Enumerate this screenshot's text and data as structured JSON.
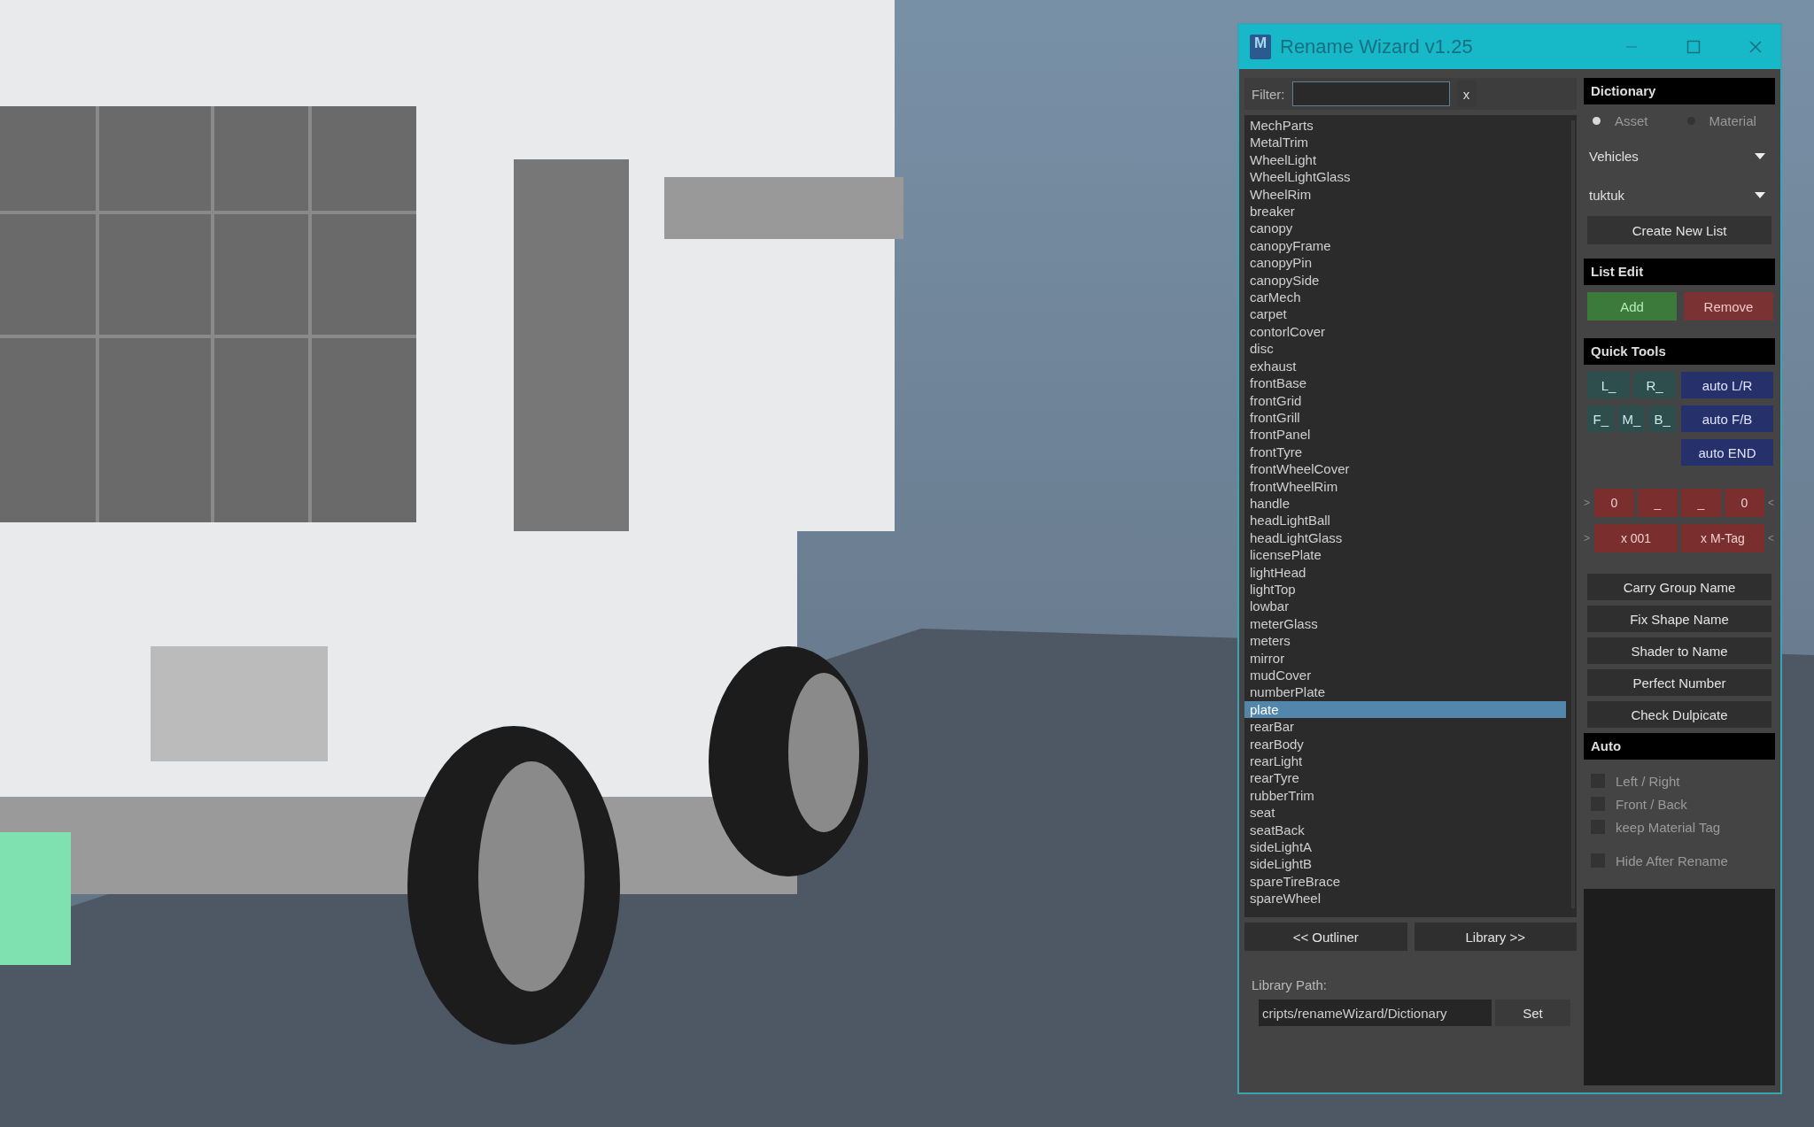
{
  "window": {
    "logo": "M",
    "title": "Rename Wizard v1.25"
  },
  "filter": {
    "label": "Filter:",
    "clear": "x"
  },
  "items": [
    {
      "name": "MechParts",
      "selected": false
    },
    {
      "name": "MetalTrim",
      "selected": false
    },
    {
      "name": "WheelLight",
      "selected": false
    },
    {
      "name": "WheelLightGlass",
      "selected": false
    },
    {
      "name": "WheelRim",
      "selected": false
    },
    {
      "name": "breaker",
      "selected": false
    },
    {
      "name": "canopy",
      "selected": false
    },
    {
      "name": "canopyFrame",
      "selected": false
    },
    {
      "name": "canopyPin",
      "selected": false
    },
    {
      "name": "canopySide",
      "selected": false
    },
    {
      "name": "carMech",
      "selected": false
    },
    {
      "name": "carpet",
      "selected": false
    },
    {
      "name": "contorlCover",
      "selected": false
    },
    {
      "name": "disc",
      "selected": false
    },
    {
      "name": "exhaust",
      "selected": false
    },
    {
      "name": "frontBase",
      "selected": false
    },
    {
      "name": "frontGrid",
      "selected": false
    },
    {
      "name": "frontGrill",
      "selected": false
    },
    {
      "name": "frontPanel",
      "selected": false
    },
    {
      "name": "frontTyre",
      "selected": false
    },
    {
      "name": "frontWheelCover",
      "selected": false
    },
    {
      "name": "frontWheelRim",
      "selected": false
    },
    {
      "name": "handle",
      "selected": false
    },
    {
      "name": "headLightBall",
      "selected": false
    },
    {
      "name": "headLightGlass",
      "selected": false
    },
    {
      "name": "licensePlate",
      "selected": false
    },
    {
      "name": "lightHead",
      "selected": false
    },
    {
      "name": "lightTop",
      "selected": false
    },
    {
      "name": "lowbar",
      "selected": false
    },
    {
      "name": "meterGlass",
      "selected": false
    },
    {
      "name": "meters",
      "selected": false
    },
    {
      "name": "mirror",
      "selected": false
    },
    {
      "name": "mudCover",
      "selected": false
    },
    {
      "name": "numberPlate",
      "selected": false
    },
    {
      "name": "plate",
      "selected": true
    },
    {
      "name": "rearBar",
      "selected": false
    },
    {
      "name": "rearBody",
      "selected": false
    },
    {
      "name": "rearLight",
      "selected": false
    },
    {
      "name": "rearTyre",
      "selected": false
    },
    {
      "name": "rubberTrim",
      "selected": false
    },
    {
      "name": "seat",
      "selected": false
    },
    {
      "name": "seatBack",
      "selected": false
    },
    {
      "name": "sideLightA",
      "selected": false
    },
    {
      "name": "sideLightB",
      "selected": false
    },
    {
      "name": "spareTireBrace",
      "selected": false
    },
    {
      "name": "spareWheel",
      "selected": false
    }
  ],
  "nav_buttons": [
    "<< Outliner",
    "Library >>"
  ],
  "library_path": {
    "label": "Library Path:",
    "value": "cripts/renameWizard/Dictionary",
    "button": "Set"
  },
  "dictionary": {
    "title": "Dictionary",
    "radios": [
      {
        "label": "Asset",
        "selected": true
      },
      {
        "label": "Material",
        "selected": false
      }
    ],
    "dropdowns": [
      "Vehicles",
      "tuktuk"
    ],
    "button": "Create New List"
  },
  "list_edit": {
    "title": "List Edit",
    "buttons": [
      {
        "label": "Add",
        "kind": "add"
      },
      {
        "label": "Remove",
        "kind": "remove"
      }
    ]
  },
  "quick_tools": {
    "title": "Quick Tools",
    "rows": [
      {
        "tags": [
          "L_",
          "R_"
        ],
        "auto": "auto L/R"
      },
      {
        "tags": [
          "F_",
          "M_",
          "B_"
        ],
        "auto": "auto F/B"
      },
      {
        "tags": [],
        "auto": "auto END"
      }
    ],
    "affix_rows": [
      {
        "left_mark": ">",
        "cells": [
          "0",
          "_",
          "_",
          "0"
        ],
        "right_mark": "<"
      },
      {
        "left_mark": ">",
        "cells": [
          "x 001",
          "x M-Tag"
        ],
        "right_mark": "<"
      }
    ],
    "actions": [
      "Carry Group Name",
      "Fix Shape Name",
      "Shader to Name",
      "Perfect Number",
      "Check Dulpicate"
    ]
  },
  "auto": {
    "title": "Auto",
    "option_groups": [
      [
        {
          "label": "Left / Right",
          "checked": false
        },
        {
          "label": "Front / Back",
          "checked": false
        },
        {
          "label": "keep Material Tag",
          "checked": false
        }
      ],
      [
        {
          "label": "Hide After Rename",
          "checked": false
        }
      ]
    ]
  }
}
